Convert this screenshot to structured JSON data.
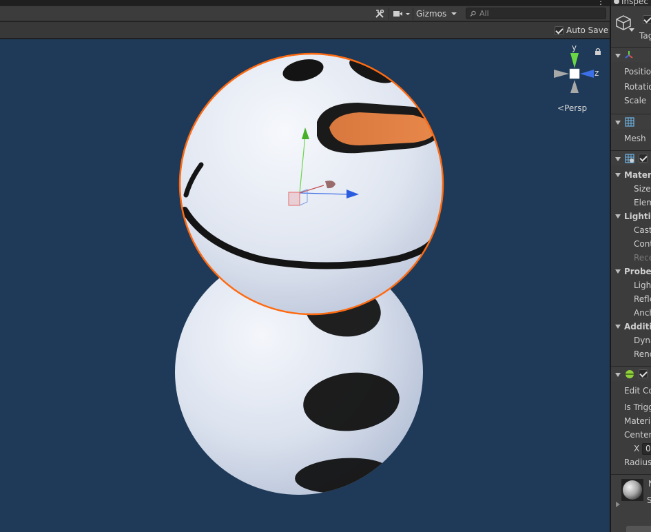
{
  "scene": {
    "toolbar": {
      "gizmos_label": "Gizmos",
      "search_placeholder": "All",
      "more_label": "⋮"
    },
    "autosave_label": "Auto Save",
    "orientation": {
      "axis_y": "y",
      "axis_z": "z",
      "projection": "Persp"
    }
  },
  "inspector": {
    "title": "Inspec",
    "tag_label": "Tag",
    "transform": {
      "position": "Position",
      "rotation": "Rotation",
      "scale": "Scale"
    },
    "mesh_filter": {
      "mesh": "Mesh"
    },
    "mesh_renderer": {
      "materials": "Materia",
      "size": "Size",
      "element": "Elem",
      "lighting": "Lighting",
      "cast": "Cast",
      "contribute": "Cont",
      "receive": "Rece",
      "probes": "Probes",
      "light": "Light",
      "reflection": "Refle",
      "anchor": "Anch",
      "additional": "Additio",
      "dynamic": "Dyna",
      "rendering": "Rend"
    },
    "sphere_collider": {
      "edit_collider": "Edit Co",
      "is_trigger": "Is Trigg",
      "material": "Materia",
      "center": "Center",
      "x_label": "X",
      "x_value": "0",
      "radius": "Radius"
    },
    "material_preview": {
      "name": "N",
      "shader": "S"
    }
  },
  "colors": {
    "viewport_bg": "#1e3a58",
    "selection_outline": "#ff6a10",
    "carrot": "#e07c3c",
    "axis_x": "#e05050",
    "axis_y": "#6ad646",
    "axis_z": "#3d6fe6"
  }
}
